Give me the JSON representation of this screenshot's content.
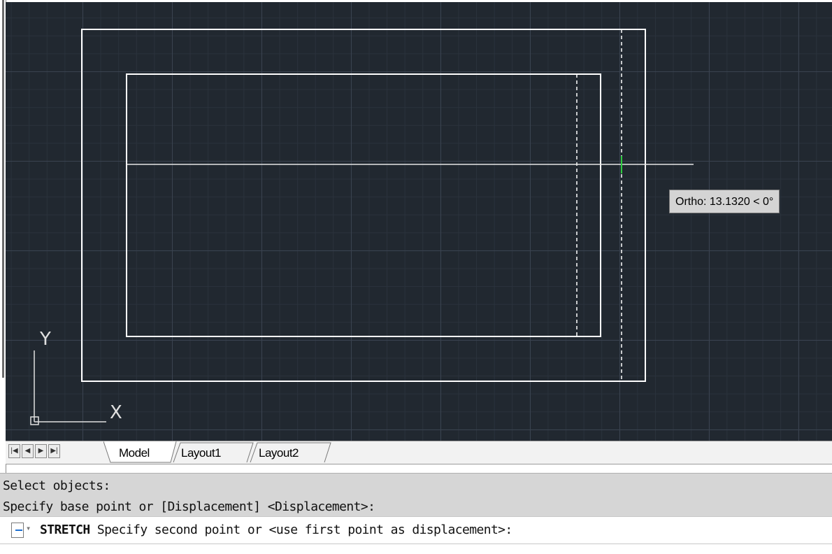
{
  "canvas": {
    "background": "#212830",
    "ortho_tooltip": "Ortho: 13.1320 < 0°",
    "ucs": {
      "x_label": "X",
      "y_label": "Y"
    }
  },
  "tabs": {
    "nav_icons": [
      "first-tab-icon",
      "prev-tab-icon",
      "next-tab-icon",
      "last-tab-icon"
    ],
    "items": [
      {
        "label": "Model",
        "active": true
      },
      {
        "label": "Layout1",
        "active": false
      },
      {
        "label": "Layout2",
        "active": false
      }
    ]
  },
  "command": {
    "history": [
      "Select objects:",
      "Specify base point or [Displacement] <Displacement>:"
    ],
    "current_command": "STRETCH",
    "current_prompt": " Specify second point or <use first point as displacement>:"
  }
}
